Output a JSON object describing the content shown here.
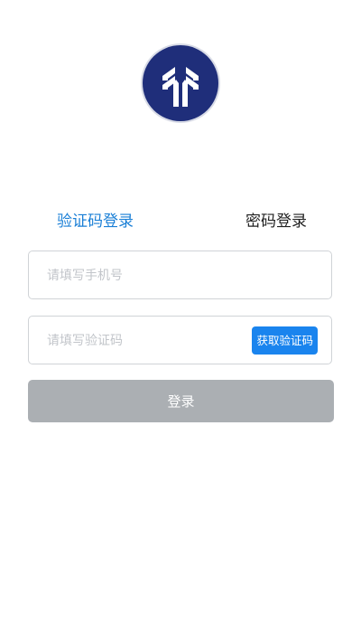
{
  "logo": {
    "icon": "company-logo",
    "bg_color": "#1f2e7a"
  },
  "tabs": [
    {
      "label": "验证码登录",
      "active": true
    },
    {
      "label": "密码登录",
      "active": false
    }
  ],
  "phone": {
    "placeholder": "请填写手机号",
    "value": ""
  },
  "code": {
    "placeholder": "请填写验证码",
    "value": "",
    "button_label": "获取验证码"
  },
  "login": {
    "label": "登录"
  },
  "colors": {
    "accent": "#1a84ee",
    "tab_active": "#1a7fd6",
    "disabled_button": "#abafb3"
  }
}
